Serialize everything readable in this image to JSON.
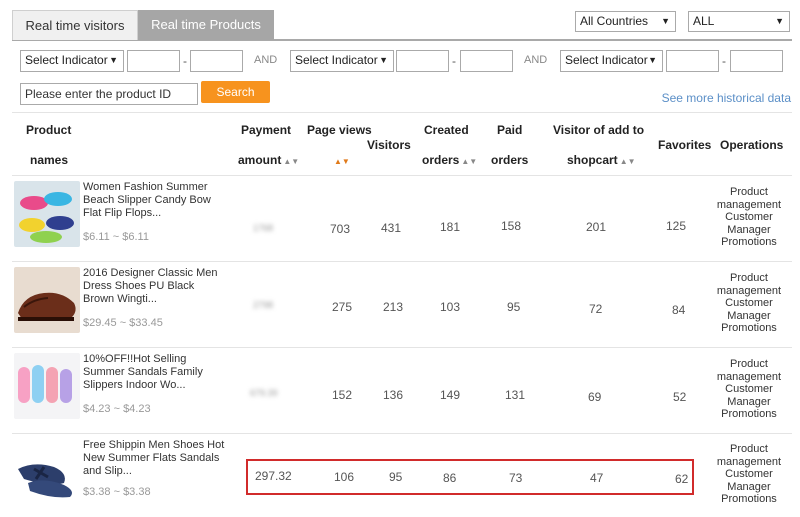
{
  "tabs": [
    {
      "label": "Real time visitors",
      "active": false
    },
    {
      "label": "Real time Products",
      "active": true
    }
  ],
  "country_select": {
    "value": "All Countries"
  },
  "all_select": {
    "value": "ALL"
  },
  "filters": {
    "indicator_placeholder": "Select Indicator",
    "and_label": "AND",
    "dash": "-",
    "product_id_placeholder": "Please enter the product ID",
    "search_label": "Search",
    "history_link": "See more historical data"
  },
  "table": {
    "headers": {
      "product_line1": "Product",
      "product_line2": "names",
      "payment_line1": "Payment",
      "payment_line2": "amount",
      "page_views": "Page views",
      "visitors": "Visitors",
      "created_line1": "Created",
      "created_line2": "orders",
      "paid_line1": "Paid",
      "paid_line2": "orders",
      "addcart_line1": "Visitor of add to",
      "addcart_line2": "shopcart",
      "favorites": "Favorites",
      "operations": "Operations"
    },
    "rows": [
      {
        "name": "Women Fashion Summer Beach Slipper Candy Bow Flat Flip Flops...",
        "price": "$6.11 ~ $6.11",
        "payment": "1768",
        "page_views": "703",
        "visitors": "431",
        "created": "181",
        "paid": "158",
        "addcart": "201",
        "favorites": "125"
      },
      {
        "name": "2016 Designer Classic Men Dress Shoes PU Black Brown Wingti...",
        "price": "$29.45 ~ $33.45",
        "payment": "2798",
        "page_views": "275",
        "visitors": "213",
        "created": "103",
        "paid": "95",
        "addcart": "72",
        "favorites": "84"
      },
      {
        "name": "10%OFF!!Hot Selling Summer Sandals Family Slippers Indoor Wo...",
        "price": "$4.23 ~ $4.23",
        "payment": "679.39",
        "page_views": "152",
        "visitors": "136",
        "created": "149",
        "paid": "131",
        "addcart": "69",
        "favorites": "52"
      },
      {
        "name": "Free Shippin Men Shoes Hot New Summer Flats Sandals and Slip...",
        "price": "$3.38 ~ $3.38",
        "payment": "297.32",
        "page_views": "106",
        "visitors": "95",
        "created": "86",
        "paid": "73",
        "addcart": "47",
        "favorites": "62"
      }
    ],
    "ops": {
      "product_line1": "Product",
      "product_line2": "management",
      "customer_line1": "Customer",
      "customer_line2": "Manager",
      "promotions": "Promotions"
    }
  },
  "colors": {
    "accent": "#f7931e",
    "link": "#5b8fc7",
    "highlight": "#d12b2b",
    "tab_active": "#a6a6a6"
  }
}
